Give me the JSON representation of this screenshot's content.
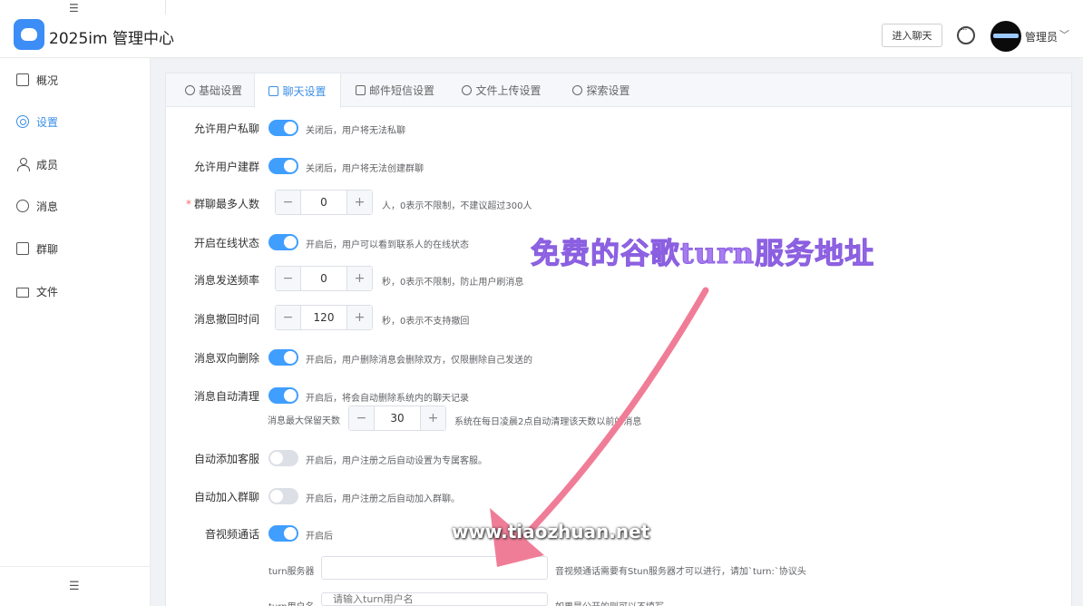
{
  "header": {
    "app_title": "2025im 管理中心",
    "enter_chat_label": "进入聊天",
    "admin_name": "管理员",
    "caret": "﹀",
    "collapse_glyph": "☰"
  },
  "sidebar": {
    "items": [
      {
        "label": "概况",
        "icon": "dashboard-icon"
      },
      {
        "label": "设置",
        "icon": "gear-icon",
        "active": true
      },
      {
        "label": "成员",
        "icon": "user-icon"
      },
      {
        "label": "消息",
        "icon": "message-icon"
      },
      {
        "label": "群聊",
        "icon": "group-chat-icon"
      },
      {
        "label": "文件",
        "icon": "folder-icon"
      }
    ],
    "collapse_glyph": "☰"
  },
  "tabs": [
    {
      "label": "基础设置"
    },
    {
      "label": "聊天设置",
      "active": true
    },
    {
      "label": "邮件短信设置"
    },
    {
      "label": "文件上传设置"
    },
    {
      "label": "探索设置"
    }
  ],
  "settings": {
    "private_chat": {
      "label": "允许用户私聊",
      "enabled": true,
      "hint": "关闭后，用户将无法私聊"
    },
    "create_group": {
      "label": "允许用户建群",
      "enabled": true,
      "hint": "关闭后，用户将无法创建群聊"
    },
    "group_max": {
      "label": "群聊最多人数",
      "required": "*",
      "value": "0",
      "hint": "人，0表示不限制，不建议超过300人"
    },
    "online_status": {
      "label": "开启在线状态",
      "enabled": true,
      "hint": "开启后，用户可以看到联系人的在线状态"
    },
    "send_rate": {
      "label": "消息发送频率",
      "value": "0",
      "hint": "秒，0表示不限制，防止用户刷消息"
    },
    "recall_time": {
      "label": "消息撤回时间",
      "value": "120",
      "hint": "秒，0表示不支持撤回"
    },
    "two_way_delete": {
      "label": "消息双向删除",
      "enabled": true,
      "hint": "开启后，用户删除消息会删除双方，仅限删除自己发送的"
    },
    "auto_clean": {
      "label": "消息自动清理",
      "enabled": true,
      "hint": "开启后，将会自动删除系统内的聊天记录"
    },
    "retain_days": {
      "label": "消息最大保留天数",
      "value": "30",
      "hint": "系统在每日凌晨2点自动清理该天数以前的消息"
    },
    "auto_service": {
      "label": "自动添加客服",
      "enabled": false,
      "hint": "开启后，用户注册之后自动设置为专属客服。"
    },
    "auto_group": {
      "label": "自动加入群聊",
      "enabled": false,
      "hint": "开启后，用户注册之后自动加入群聊。"
    },
    "av_call": {
      "label": "音视频通话",
      "enabled": true,
      "hint": "开启后"
    },
    "turn_server": {
      "label": "turn服务器",
      "value": "",
      "hint": "音视频通话需要有Stun服务器才可以进行，请加`turn:`协议头"
    },
    "turn_user": {
      "label": "turn用户名",
      "placeholder": "请输入turn用户名",
      "hint": "如果是公开的则可以不填写"
    }
  },
  "stepper": {
    "minus": "−",
    "plus": "+"
  },
  "annotation": {
    "overlay_text": "免费的谷歌turn服务地址",
    "watermark": "www.tiaozhuan.net",
    "arrow_color": "#f07d97",
    "overlay_color": "#a77cf0"
  },
  "colors": {
    "accent": "#409eff",
    "switch_off": "#dcdfe6",
    "required": "#f56c6c"
  }
}
